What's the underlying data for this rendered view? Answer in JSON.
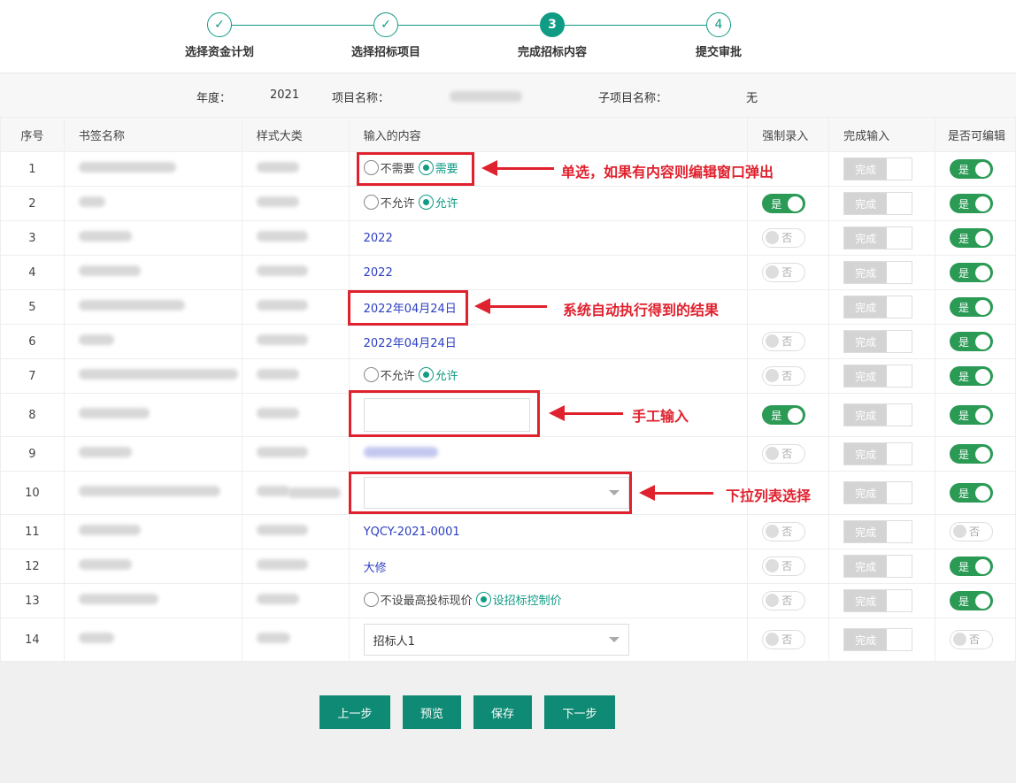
{
  "steps": [
    "选择资金计划",
    "选择招标项目",
    "完成招标内容",
    "提交审批"
  ],
  "step_nums": [
    "3",
    "4"
  ],
  "check": "✓",
  "info": {
    "year_label": "年度：",
    "year": "2021",
    "project_label": "项目名称：",
    "sub_label": "子项目名称：",
    "sub_value": "无"
  },
  "headers": [
    "序号",
    "书签名称",
    "样式大类",
    "输入的内容",
    "强制录入",
    "完成输入",
    "是否可编辑"
  ],
  "rows": [
    {
      "no": "1",
      "type": "radio",
      "opts": [
        "不需要",
        "需要"
      ],
      "sel": 1,
      "force": null,
      "edit": "on"
    },
    {
      "no": "2",
      "type": "radio",
      "opts": [
        "不允许",
        "允许"
      ],
      "sel": 1,
      "force": "on",
      "edit": "on"
    },
    {
      "no": "3",
      "type": "text",
      "value": "2022",
      "force": "off",
      "edit": "on"
    },
    {
      "no": "4",
      "type": "text",
      "value": "2022",
      "force": "off",
      "edit": "on"
    },
    {
      "no": "5",
      "type": "text",
      "value": "2022年04月24日",
      "force": null,
      "edit": "on"
    },
    {
      "no": "6",
      "type": "text",
      "value": "2022年04月24日",
      "force": "off",
      "edit": "on"
    },
    {
      "no": "7",
      "type": "radio",
      "opts": [
        "不允许",
        "允许"
      ],
      "sel": 1,
      "force": "off",
      "edit": "on"
    },
    {
      "no": "8",
      "type": "input",
      "force": "on",
      "edit": "on"
    },
    {
      "no": "9",
      "type": "blur",
      "force": "off",
      "edit": "on"
    },
    {
      "no": "10",
      "type": "select",
      "value": "",
      "force": null,
      "edit": "on"
    },
    {
      "no": "11",
      "type": "text",
      "value": "YQCY-2021-0001",
      "force": "off",
      "edit": "off"
    },
    {
      "no": "12",
      "type": "text",
      "value": "大修",
      "force": "off",
      "edit": "on"
    },
    {
      "no": "13",
      "type": "radio",
      "opts": [
        "不设最高投标现价",
        "设招标控制价"
      ],
      "sel": 1,
      "force": "off",
      "edit": "on"
    },
    {
      "no": "14",
      "type": "select",
      "value": "招标人1",
      "force": "off",
      "edit": "off"
    }
  ],
  "toggle": {
    "on": "是",
    "off": "否"
  },
  "done_label": "完成",
  "notes": [
    "单选，如果有内容则编辑窗口弹出",
    "系统自动执行得到的结果",
    "手工输入",
    "下拉列表选择"
  ],
  "buttons": [
    "上一步",
    "预览",
    "保存",
    "下一步"
  ],
  "colors": {
    "accent": "#0f9b84",
    "toggle_on": "#2a9a55",
    "annotation": "#e0212e"
  }
}
